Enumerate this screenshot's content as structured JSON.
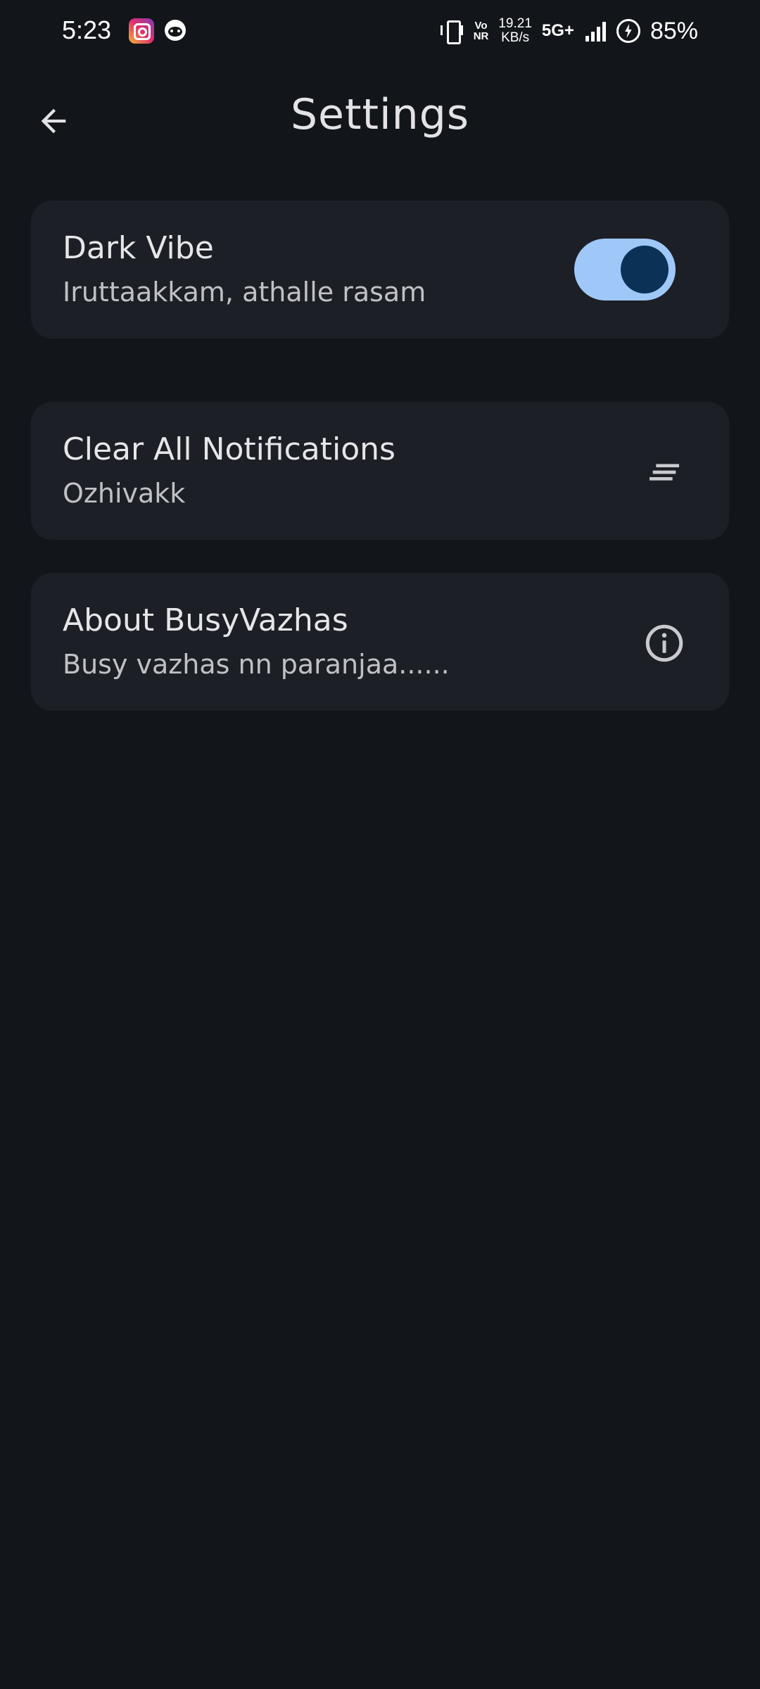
{
  "status_bar": {
    "time": "5:23",
    "icons": [
      "instagram-icon",
      "reddit-icon",
      "vibrate-icon",
      "signal-icon",
      "battery-charging-icon"
    ],
    "vonr_top": "Vo",
    "vonr_bottom": "NR",
    "speed_value": "19.21",
    "speed_unit": "KB/s",
    "network_type": "5G+",
    "battery_percent": "85%"
  },
  "app_bar": {
    "back_icon": "arrow-back-icon",
    "title": "Settings"
  },
  "settings": {
    "dark_vibe": {
      "title": "Dark Vibe",
      "subtitle": "Iruttaakkam, athalle rasam",
      "toggle_on": true
    },
    "clear_notifications": {
      "title": "Clear All Notifications",
      "subtitle": "Ozhivakk",
      "icon": "clear-all-icon"
    },
    "about": {
      "title": "About BusyVazhas",
      "subtitle": "Busy vazhas nn paranjaa......",
      "icon": "info-icon"
    }
  },
  "colors": {
    "background": "#12151a",
    "card": "#1c1f25",
    "toggle_track": "#9fc8f8",
    "toggle_knob": "#0c3157",
    "text_primary": "#e6e6e8",
    "text_secondary": "#bfc1c6"
  }
}
